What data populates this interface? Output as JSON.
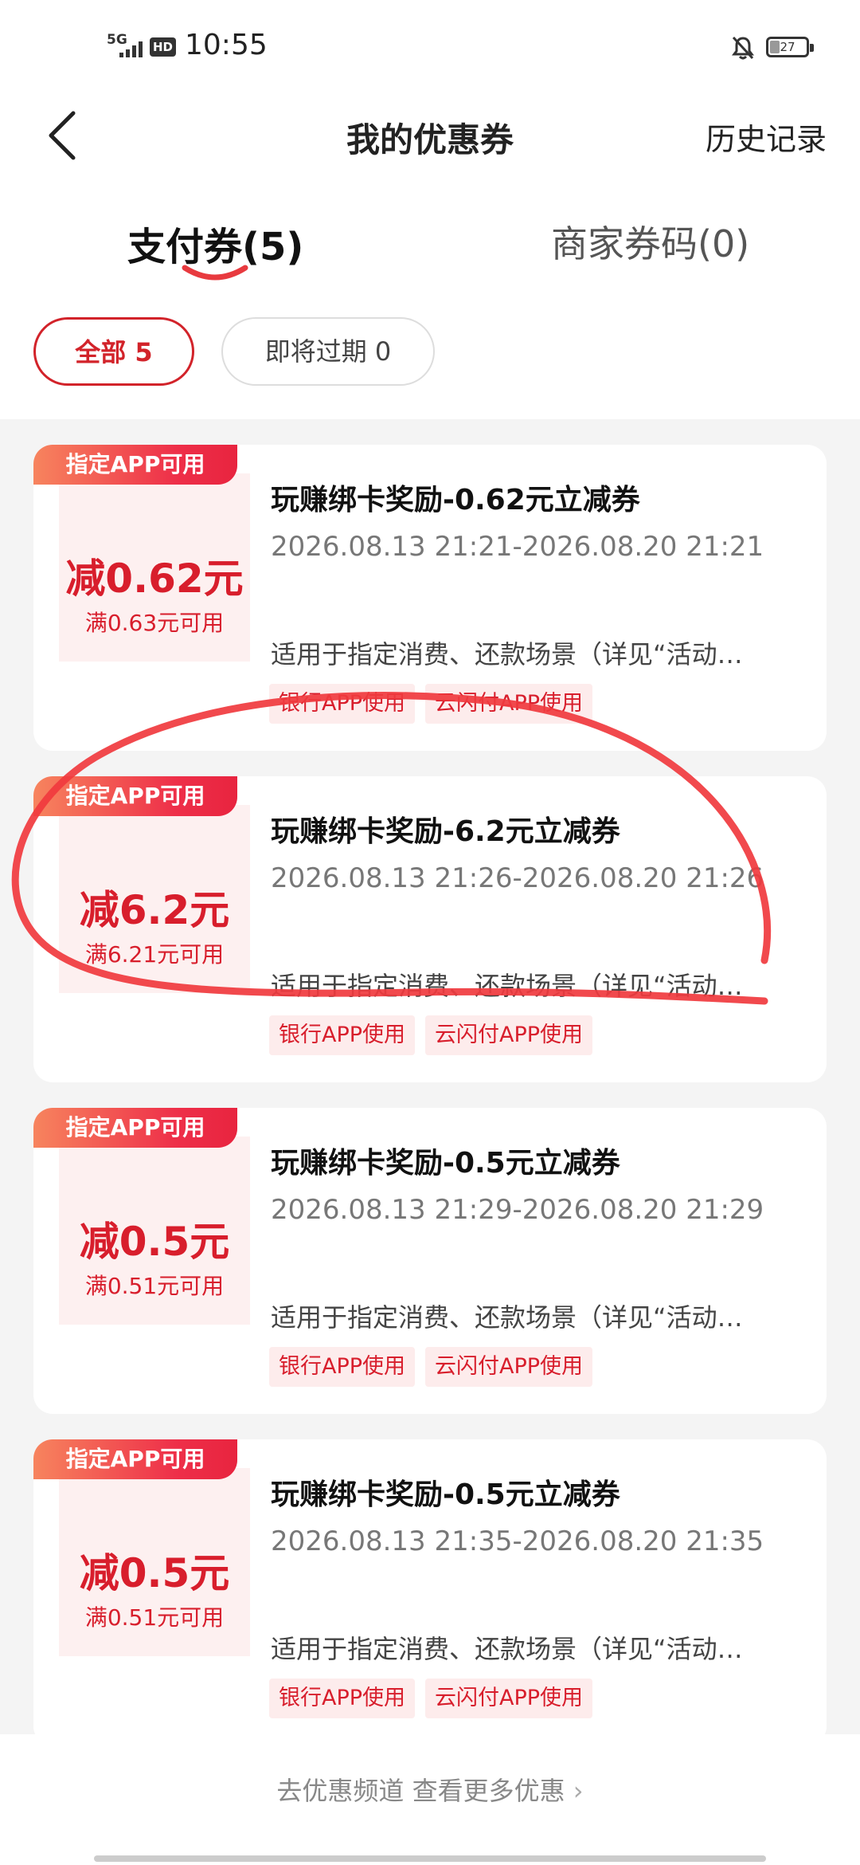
{
  "status_bar": {
    "network": "5G",
    "hd": "HD",
    "time": "10:55",
    "battery": "27",
    "battery_level": 0.27
  },
  "nav": {
    "title": "我的优惠券",
    "history": "历史记录"
  },
  "tabs": [
    {
      "label": "支付券(5)",
      "active": true
    },
    {
      "label": "商家券码(0)",
      "active": false
    }
  ],
  "filters": [
    {
      "label": "全部 5",
      "active": true
    },
    {
      "label": "即将过期 0",
      "active": false
    }
  ],
  "coupons": [
    {
      "ribbon": "指定APP可用",
      "amount": "减0.62元",
      "threshold": "满0.63元可用",
      "title": "玩赚绑卡奖励-0.62元立减券",
      "period": "2026.08.13 21:21-2026.08.20 21:21",
      "desc": "适用于指定消费、还款场景（详见“活动…",
      "tags": [
        "银行APP使用",
        "云闪付APP使用"
      ]
    },
    {
      "ribbon": "指定APP可用",
      "amount": "减6.2元",
      "threshold": "满6.21元可用",
      "title": "玩赚绑卡奖励-6.2元立减券",
      "period": "2026.08.13 21:26-2026.08.20 21:26",
      "desc": "适用于指定消费、还款场景（详见“活动…",
      "tags": [
        "银行APP使用",
        "云闪付APP使用"
      ]
    },
    {
      "ribbon": "指定APP可用",
      "amount": "减0.5元",
      "threshold": "满0.51元可用",
      "title": "玩赚绑卡奖励-0.5元立减券",
      "period": "2026.08.13 21:29-2026.08.20 21:29",
      "desc": "适用于指定消费、还款场景（详见“活动…",
      "tags": [
        "银行APP使用",
        "云闪付APP使用"
      ]
    },
    {
      "ribbon": "指定APP可用",
      "amount": "减0.5元",
      "threshold": "满0.51元可用",
      "title": "玩赚绑卡奖励-0.5元立减券",
      "period": "2026.08.13 21:35-2026.08.20 21:35",
      "desc": "适用于指定消费、还款场景（详见“活动…",
      "tags": [
        "银行APP使用",
        "云闪付APP使用"
      ]
    }
  ],
  "footer": {
    "more": "去优惠频道 查看更多优惠"
  },
  "colors": {
    "accent": "#d2232a",
    "ribbon_start": "#f7845e",
    "ribbon_end": "#e8243f",
    "annotation": "#f03a3e"
  }
}
